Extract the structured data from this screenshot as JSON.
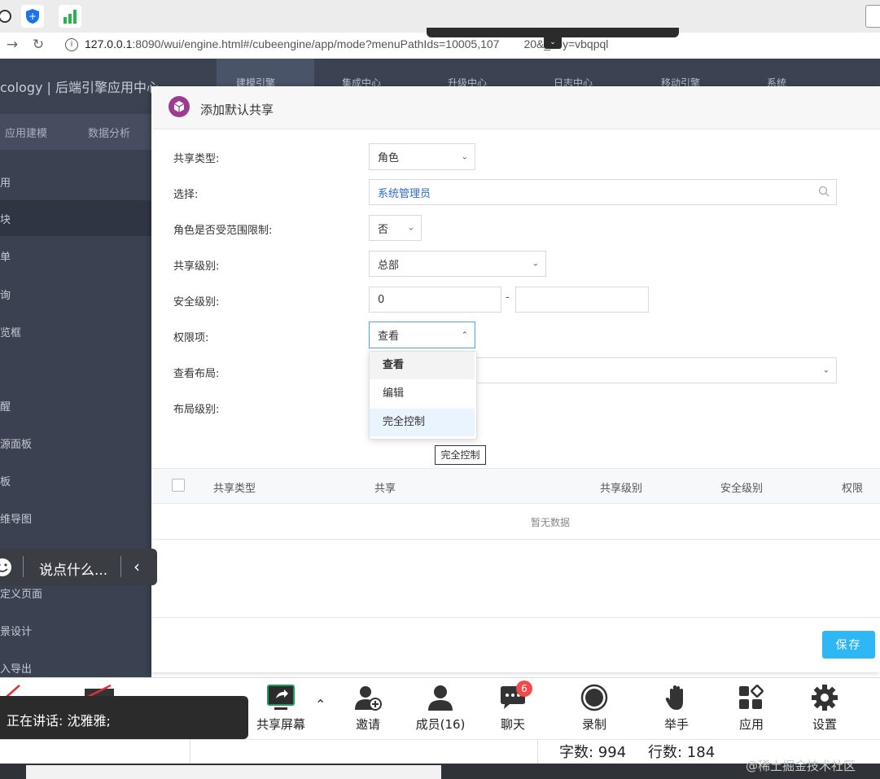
{
  "browser": {
    "url_host": "127.0.0.1",
    "url_rest": ":8090/wui/engine.html#/cubeengine/app/mode?menuPathIds=10005,107",
    "url_tail": "20&_key=vbqpql"
  },
  "app": {
    "title": "cology | 后端引擎应用中心",
    "top_menu": [
      "建模引擎",
      "集成中心",
      "升级中心",
      "日志中心",
      "移动引擎",
      "系统"
    ],
    "side_tabs": [
      "应用建模",
      "数据分析"
    ],
    "side_items": [
      "用",
      "块",
      "单",
      "询",
      "览框",
      "醒",
      "源面板",
      "板",
      "维导图",
      "定义页面",
      "景设计",
      "入导出"
    ]
  },
  "dialog": {
    "title": "添加默认共享",
    "fields": {
      "share_type": {
        "label": "共享类型:",
        "value": "角色"
      },
      "select": {
        "label": "选择:",
        "value": "系统管理员"
      },
      "role_range": {
        "label": "角色是否受范围限制:",
        "value": "否"
      },
      "share_level": {
        "label": "共享级别:",
        "value": "总部"
      },
      "security_level": {
        "label": "安全级别:",
        "from": "0",
        "to": "",
        "separator": "-"
      },
      "permission": {
        "label": "权限项:",
        "value": "查看"
      },
      "view_layout": {
        "label": "查看布局:",
        "value": ""
      },
      "layout_level": {
        "label": "布局级别:"
      }
    },
    "permission_options": [
      "查看",
      "编辑",
      "完全控制"
    ],
    "tooltip": "完全控制",
    "table": {
      "headers": [
        "共享类型",
        "共享",
        "共享级别",
        "安全级别",
        "权限"
      ],
      "empty_text": "暂无数据"
    },
    "save_label": "保存"
  },
  "chat": {
    "placeholder": "说点什么..."
  },
  "meeting": {
    "speaking": "正在讲话: 沈雅雅;",
    "buttons": [
      "共享屏幕",
      "邀请",
      "成员(16)",
      "聊天",
      "录制",
      "举手",
      "应用",
      "设置"
    ],
    "chat_badge": "6"
  },
  "status": {
    "word_count": "字数: 994",
    "line_count": "行数: 184"
  },
  "watermark": "@稀土掘金技术社区"
}
